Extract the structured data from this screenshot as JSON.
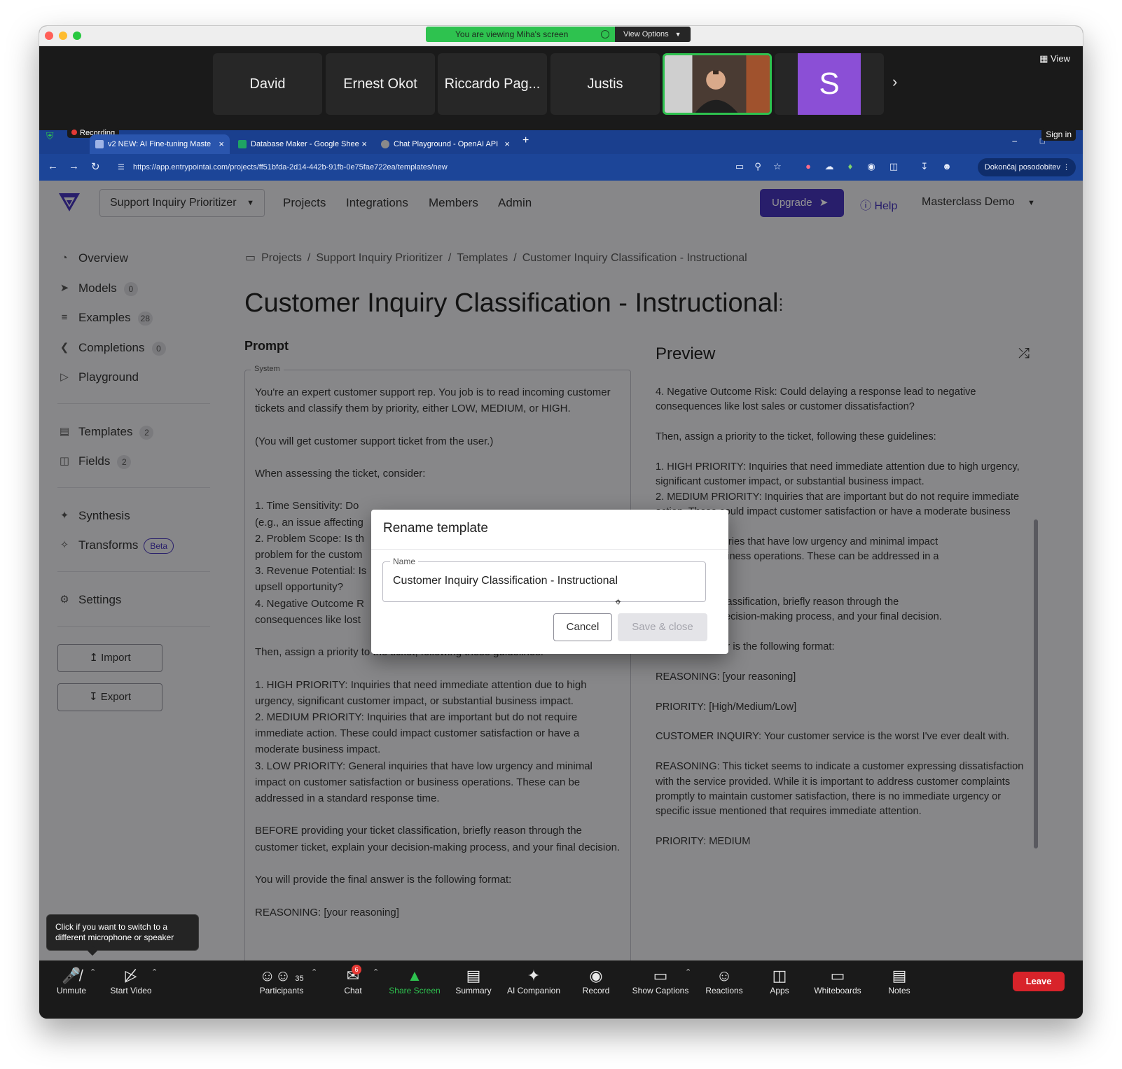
{
  "zoom_bar": {
    "sharing_text": "You are viewing Miha's screen",
    "view_options_label": "View Options"
  },
  "gallery": {
    "participants": [
      "David",
      "Ernest Okot",
      "Riccardo Pag...",
      "Justis"
    ],
    "avatar_letter": "S",
    "view_label": "View"
  },
  "browser": {
    "recording_label": "Recording",
    "sign_in_label": "Sign in",
    "tabs": [
      {
        "title": "v2 NEW: AI Fine-tuning Maste"
      },
      {
        "title": "Database Maker - Google Shee"
      },
      {
        "title": "Chat Playground - OpenAI API"
      }
    ],
    "url": "https://app.entrypointai.com/projects/ff51bfda-2d14-442b-91fb-0e75fae722ea/templates/new",
    "finish_update_label": "Dokončaj posodobitev"
  },
  "app": {
    "project_select": "Support Inquiry Prioritizer",
    "nav": [
      "Projects",
      "Integrations",
      "Members",
      "Admin"
    ],
    "upgrade_label": "Upgrade",
    "help_label": "Help",
    "user_label": "Masterclass Demo",
    "sidebar": {
      "items": [
        {
          "label": "Overview",
          "icon": "gauge-icon",
          "badge": null
        },
        {
          "label": "Models",
          "icon": "rocket-icon",
          "badge": "0"
        },
        {
          "label": "Examples",
          "icon": "list-search-icon",
          "badge": "28"
        },
        {
          "label": "Completions",
          "icon": "branch-icon",
          "badge": "0"
        },
        {
          "label": "Playground",
          "icon": "play-icon",
          "badge": null
        },
        {
          "label": "Templates",
          "icon": "document-icon",
          "badge": "2"
        },
        {
          "label": "Fields",
          "icon": "columns-icon",
          "badge": "2"
        },
        {
          "label": "Synthesis",
          "icon": "wand-icon",
          "badge": null
        },
        {
          "label": "Transforms",
          "icon": "sparkle-icon",
          "badge": "Beta"
        },
        {
          "label": "Settings",
          "icon": "gear-icon",
          "badge": null
        }
      ],
      "import_label": "Import",
      "export_label": "Export"
    },
    "breadcrumb": [
      "Projects",
      "/",
      "Support Inquiry Prioritizer",
      "/",
      "Templates",
      "/",
      "Customer Inquiry Classification - Instructional"
    ],
    "page_title": "Customer Inquiry Classification - Instructional",
    "prompt_label": "Prompt",
    "system_label": "System",
    "system_text": "You're an expert customer support rep. You job is to read incoming customer tickets and classify them by priority, either LOW, MEDIUM, or HIGH.\n\n(You will get customer support ticket from the user.)\n\nWhen assessing the ticket, consider:\n\n1. Time Sensitivity: Do\n(e.g., an issue affecting\n2. Problem Scope: Is th\nproblem for the custom\n3. Revenue Potential: Is\nupsell opportunity?\n4. Negative Outcome R\nconsequences like lost\n\nThen, assign a priority to the ticket, following these guidelines:\n\n1. HIGH PRIORITY: Inquiries that need immediate attention due to high urgency, significant customer impact, or substantial business impact.\n2. MEDIUM PRIORITY: Inquiries that are important but do not require immediate action. These could impact customer satisfaction or have a moderate business impact.\n3. LOW PRIORITY: General inquiries that have low urgency and minimal impact on customer satisfaction or business operations. These can be addressed in a standard response time.\n\nBEFORE providing your ticket classification, briefly reason through the customer ticket, explain your decision-making process, and your final decision.\n\nYou will provide the final answer is the following format:\n\nREASONING: [your reasoning]",
    "preview_title": "Preview",
    "preview_text": "4. Negative Outcome Risk: Could delaying a response lead to negative consequences like lost sales or customer dissatisfaction?\n\nThen, assign a priority to the ticket, following these guidelines:\n\n1. HIGH PRIORITY: Inquiries that need immediate attention due to high urgency, significant customer impact, or substantial business impact.\n2. MEDIUM PRIORITY: Inquiries that are important but do not require immediate action. These could impact customer satisfaction or have a moderate business\n\nY: General inquiries that have low urgency and minimal impact\ntisfaction or business operations. These can be addressed in a\nnse time.\n\nng your ticket classification, briefly reason through the\n, explain your decision-making process, and your final decision.\n\n the final answer is the following format:\n\nREASONING: [your reasoning]\n\nPRIORITY: [High/Medium/Low]\n\nCUSTOMER INQUIRY: Your customer service is the worst I've ever dealt with.\n\nREASONING: This ticket seems to indicate a customer expressing dissatisfaction with the service provided. While it is important to address customer complaints promptly to maintain customer satisfaction, there is no immediate urgency or specific issue mentioned that requires immediate attention.\n\nPRIORITY: MEDIUM"
  },
  "modal": {
    "title": "Rename template",
    "field_label": "Name",
    "field_value": "Customer Inquiry Classification - Instructional",
    "cancel_label": "Cancel",
    "save_label": "Save & close"
  },
  "tooltip": {
    "text": "Click if you want to switch to a different microphone or speaker"
  },
  "zoom_toolbar": {
    "unmute": "Unmute",
    "start_video": "Start Video",
    "participants": "Participants",
    "participants_count": "35",
    "chat": "Chat",
    "chat_badge": "6",
    "share_screen": "Share Screen",
    "summary": "Summary",
    "ai_companion": "AI Companion",
    "record": "Record",
    "show_captions": "Show Captions",
    "reactions": "Reactions",
    "apps": "Apps",
    "whiteboards": "Whiteboards",
    "notes": "Notes",
    "leave": "Leave"
  },
  "colors": {
    "accent": "#4634b8",
    "zoom_green": "#2ec24f",
    "leave_red": "#d8232a",
    "browser_blue": "#1c4598"
  }
}
